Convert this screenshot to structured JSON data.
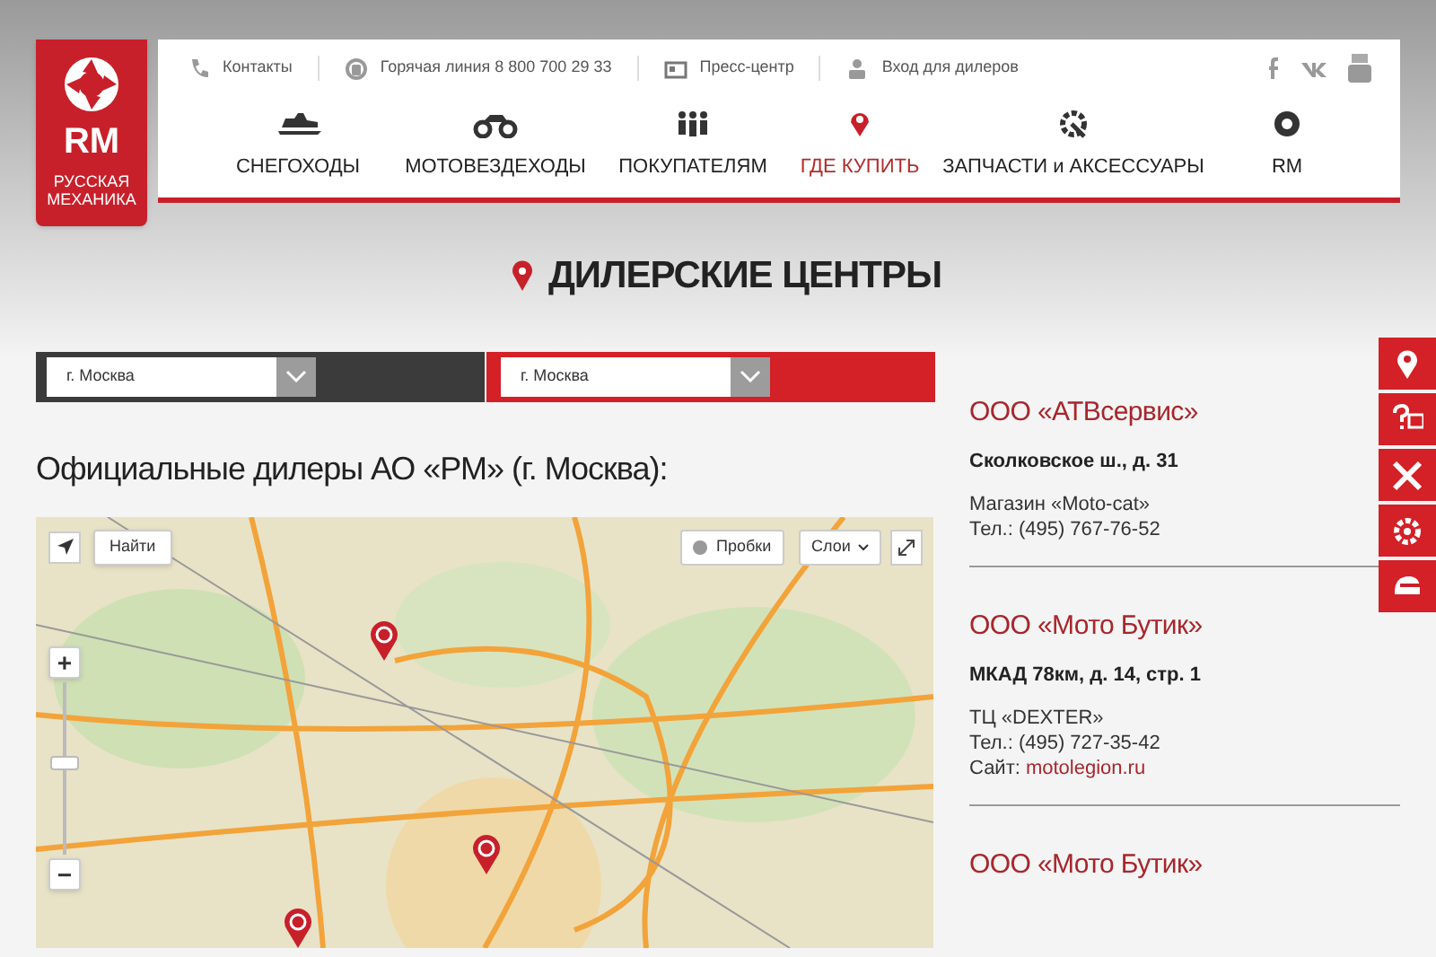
{
  "logo": {
    "mark": "RM",
    "name": "РУССКАЯ МЕХАНИКА"
  },
  "top_links": [
    {
      "label": "Контакты"
    },
    {
      "label": "Горячая линия 8 800 700 29 33"
    },
    {
      "label": "Пресс-центр"
    },
    {
      "label": "Вход для дилеров"
    }
  ],
  "nav": [
    {
      "label": "СНЕГОХОДЫ",
      "selected": false
    },
    {
      "label": "МОТОВЕЗДЕХОДЫ",
      "selected": false
    },
    {
      "label": "ПОКУПАТЕЛЯМ",
      "selected": false
    },
    {
      "label": "ГДЕ КУПИТЬ",
      "selected": true
    },
    {
      "label": "ЗАПЧАСТИ и АКСЕССУАРЫ",
      "selected": false
    },
    {
      "label": "RM",
      "selected": false
    }
  ],
  "page_title": "ДИЛЕРСКИЕ ЦЕНТРЫ",
  "filters": [
    {
      "value": "г. Москва"
    },
    {
      "value": "г. Москва"
    }
  ],
  "heading": "Официальные дилеры АО «РМ» (г. Москва):",
  "map": {
    "find_button": "Найти",
    "traffic_button": "Пробки",
    "layers_button": "Слои",
    "zoom_in": "+",
    "zoom_out": "−",
    "zoom_slider": {
      "level": 0.53
    }
  },
  "dealers": [
    {
      "name": "ООО «АТВсервис»",
      "address": "Сколковское ш., д. 31",
      "details": [
        "Магазин «Moto-cat»",
        "Тел.: (495) 767-76-52"
      ]
    },
    {
      "name": "ООО «Мото Бутик»",
      "address": "МКАД 78км, д. 14, стр. 1",
      "details": [
        "ТЦ «DEXTER»",
        "Тел.: (495) 727-35-42"
      ],
      "site_label": "Сайт:",
      "site": "motolegion.ru"
    },
    {
      "name": "ООО «Мото Бутик»"
    }
  ]
}
